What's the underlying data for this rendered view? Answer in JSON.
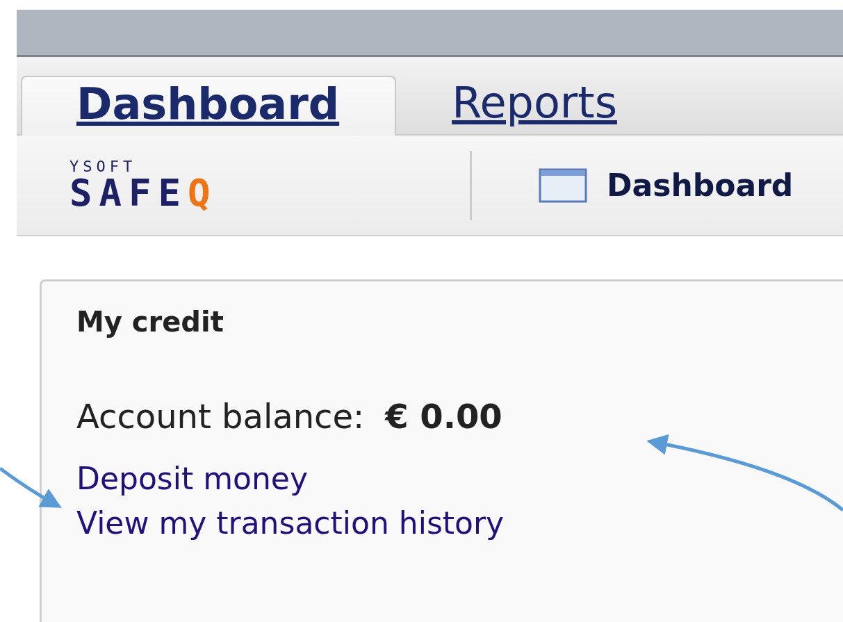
{
  "tabs": [
    {
      "label": "Dashboard",
      "selected": true
    },
    {
      "label": "Reports",
      "selected": false
    }
  ],
  "logo": {
    "top": "YSOFT",
    "main": "SAFE",
    "accent": "Q"
  },
  "toolbar": {
    "label": "Dashboard"
  },
  "credit_panel": {
    "title": "My credit",
    "balance_label": "Account balance:",
    "balance": "€ 0.00",
    "links": [
      "Deposit money",
      "View my transaction history"
    ]
  }
}
